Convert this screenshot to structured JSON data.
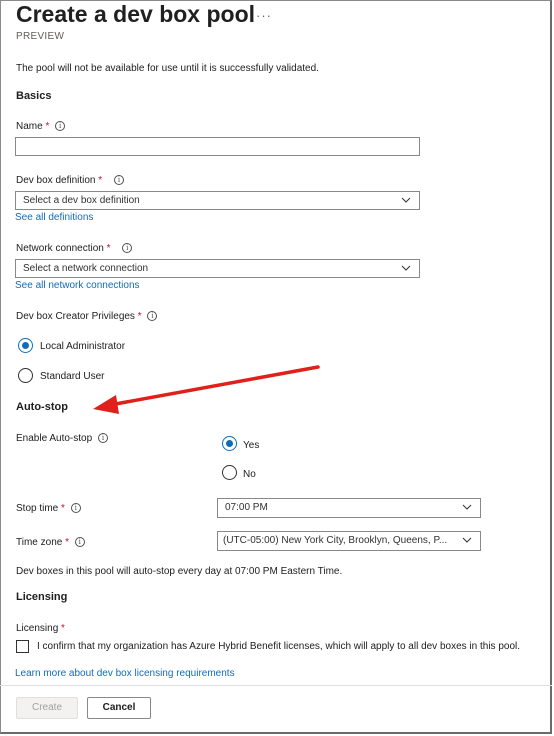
{
  "header": {
    "title": "Create a dev box pool",
    "more_label": "···",
    "subtitle": "PREVIEW"
  },
  "notice": "The pool will not be available for use until it is successfully validated.",
  "basics": {
    "heading": "Basics",
    "name": {
      "label": "Name",
      "required_mark": "*",
      "value": ""
    },
    "dev_box_definition": {
      "label": "Dev box definition",
      "required_mark": "*",
      "placeholder": "Select a dev box definition",
      "link": "See all definitions"
    },
    "network_connection": {
      "label": "Network connection",
      "required_mark": "*",
      "placeholder": "Select a network connection",
      "link": "See all network connections"
    },
    "creator_privileges": {
      "label": "Dev box Creator Privileges",
      "required_mark": "*",
      "options": [
        "Local Administrator",
        "Standard User"
      ],
      "selected": "Local Administrator"
    }
  },
  "auto_stop": {
    "heading": "Auto-stop",
    "enable_label": "Enable Auto-stop",
    "options": [
      "Yes",
      "No"
    ],
    "selected": "Yes",
    "stop_time": {
      "label": "Stop time",
      "required_mark": "*",
      "value": "07:00 PM"
    },
    "time_zone": {
      "label": "Time zone",
      "required_mark": "*",
      "value": "(UTC-05:00) New York City, Brooklyn, Queens, P..."
    },
    "summary": "Dev boxes in this pool will auto-stop every day at 07:00 PM Eastern Time."
  },
  "licensing": {
    "heading": "Licensing",
    "label": "Licensing",
    "required_mark": "*",
    "checkbox_label": "I confirm that my organization has Azure Hybrid Benefit licenses, which will apply to all dev boxes in this pool.",
    "checked": false,
    "link": "Learn more about dev box licensing requirements"
  },
  "footer": {
    "create_label": "Create",
    "cancel_label": "Cancel"
  },
  "annotation": {
    "arrow_color": "#e0201b"
  },
  "colors": {
    "accent": "#0f6cbd",
    "required": "#c50f1f"
  }
}
